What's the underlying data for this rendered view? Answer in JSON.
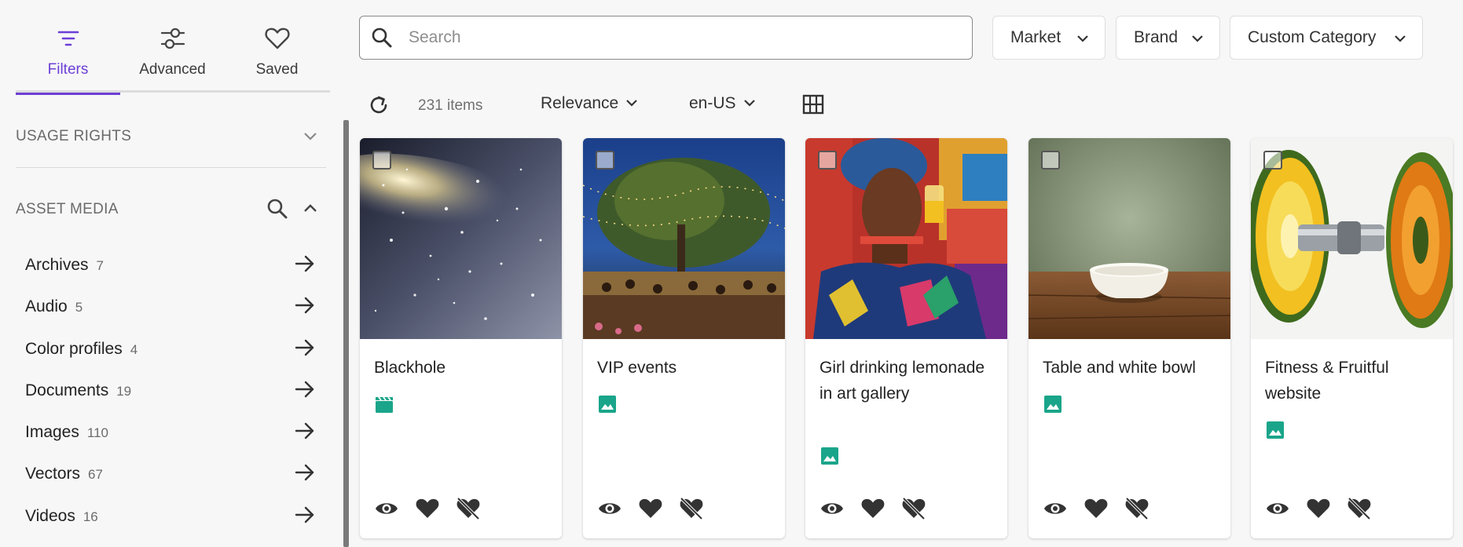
{
  "sidebar": {
    "tabs": [
      {
        "label": "Filters",
        "icon": "filter-lines-icon",
        "active": true
      },
      {
        "label": "Advanced",
        "icon": "sliders-icon",
        "active": false
      },
      {
        "label": "Saved",
        "icon": "heart-outline-icon",
        "active": false
      }
    ],
    "sections": {
      "usage_rights": {
        "title": "USAGE RIGHTS",
        "expanded": false
      },
      "asset_media": {
        "title": "ASSET MEDIA",
        "expanded": true
      }
    },
    "facets": [
      {
        "name": "Archives",
        "count": "7"
      },
      {
        "name": "Audio",
        "count": "5"
      },
      {
        "name": "Color profiles",
        "count": "4"
      },
      {
        "name": "Documents",
        "count": "19"
      },
      {
        "name": "Images",
        "count": "110"
      },
      {
        "name": "Vectors",
        "count": "67"
      },
      {
        "name": "Videos",
        "count": "16"
      }
    ]
  },
  "search": {
    "placeholder": "Search",
    "value": ""
  },
  "filters": {
    "market": "Market",
    "brand": "Brand",
    "custom_category": "Custom Category"
  },
  "toolbar": {
    "items_count": "231 items",
    "sort": "Relevance",
    "locale": "en-US",
    "refresh_icon": "refresh-icon",
    "view_icon": "grid-view-icon"
  },
  "colors": {
    "accent": "#6c3fd6",
    "type_icon": "#1aa58a"
  },
  "assets": [
    {
      "title": "Blackhole",
      "type_icon": "video-clapper-icon"
    },
    {
      "title": "VIP events",
      "type_icon": "image-icon"
    },
    {
      "title": "Girl drinking lemonade in art gallery",
      "type_icon": "image-icon"
    },
    {
      "title": "Table and white bowl",
      "type_icon": "image-icon"
    },
    {
      "title": "Fitness & Fruitful website",
      "type_icon": "image-icon"
    }
  ]
}
